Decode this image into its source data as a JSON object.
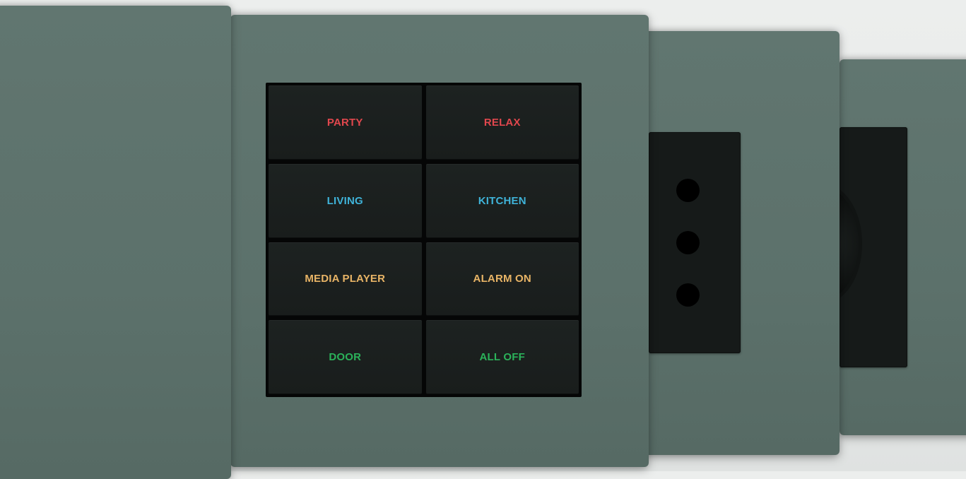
{
  "colors": {
    "red": "#e0474d",
    "blue": "#3fb3d9",
    "amber": "#e8b466",
    "green": "#2bb25a"
  },
  "keypad": {
    "keys": [
      {
        "label": "PARTY",
        "color": "#e0474d"
      },
      {
        "label": "RELAX",
        "color": "#e0474d"
      },
      {
        "label": "LIVING",
        "color": "#3fb3d9"
      },
      {
        "label": "KITCHEN",
        "color": "#3fb3d9"
      },
      {
        "label": "MEDIA PLAYER",
        "color": "#e8b466"
      },
      {
        "label": "ALARM ON",
        "color": "#e8b466"
      },
      {
        "label": "DOOR",
        "color": "#2bb25a"
      },
      {
        "label": "ALL OFF",
        "color": "#2bb25a"
      }
    ]
  }
}
